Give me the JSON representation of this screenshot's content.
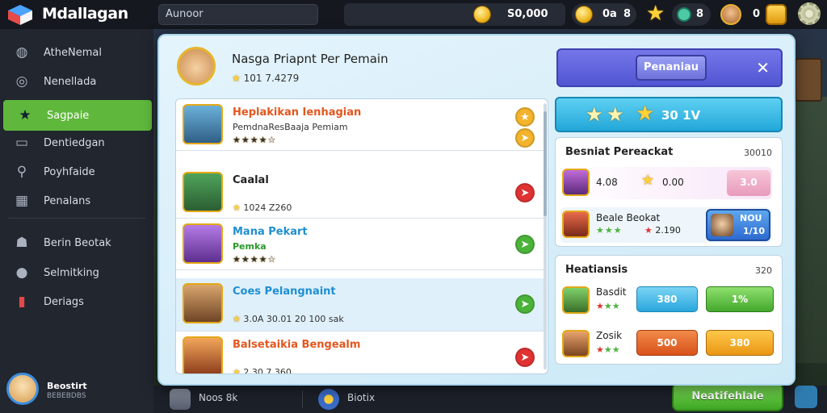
{
  "app": {
    "title": "Mdallagan",
    "search_value": "Aunoor"
  },
  "topbar": {
    "coins_value": "S0,000",
    "energy_value": "0a",
    "energy_sub": "8",
    "gems_value": "8",
    "player_value": "0"
  },
  "sidebar": {
    "items": [
      {
        "label": "AtheNemal",
        "icon": "profile-icon"
      },
      {
        "label": "Nenellada",
        "icon": "groups-icon"
      },
      {
        "label": "Sagpaie",
        "icon": "star-icon"
      },
      {
        "label": "Dentiedgan",
        "icon": "cards-icon"
      },
      {
        "label": "Poyhfaide",
        "icon": "search-icon"
      },
      {
        "label": "Penalans",
        "icon": "grid-icon"
      },
      {
        "label": "Berin Beotak",
        "icon": "people-icon"
      },
      {
        "label": "Selmitking",
        "icon": "chat-icon"
      },
      {
        "label": "Deriags",
        "icon": "alert-icon"
      }
    ],
    "profile_name": "Beostirt",
    "profile_sub": "BEBEBDBS"
  },
  "modal": {
    "title": "Nasga Priapnt Per Pemain",
    "subtitle": "101 7.4279",
    "top_button_label": "Penaniau",
    "stars_banner_value": "30 1V",
    "list": [
      {
        "name": "Heplakikan Ienhagian",
        "line2": "PemdnaResBaaja Pemiam",
        "stars": "★★★★☆",
        "action": "star",
        "name_color": "#e2571f"
      },
      {
        "name": "Caalal",
        "line2": "",
        "line3": "1024 Z260",
        "stars": "★",
        "action": "red",
        "name_color": "#222"
      },
      {
        "name": "Mana Pekart",
        "line2": "Pemka",
        "stars": "★★★★☆",
        "action": "green",
        "name_color": "#1f8fd0"
      },
      {
        "name": "Coes Pelangnaint",
        "line2": "",
        "line3": "3.0A  30.01  20 100 sak",
        "stars": "★",
        "action": "green",
        "name_color": "#1f8fd0"
      },
      {
        "name": "Balsetaikia Bengealm",
        "line2": "",
        "line3": "2.30 7.360",
        "stars": "★",
        "action": "red",
        "name_color": "#e2571f"
      }
    ],
    "recent": {
      "title": "Besniat Pereackat",
      "count": "30010",
      "row1_a": "4.08",
      "row1_b": "0.00",
      "row1_c": "3.0",
      "row2_name": "Beale Beokat",
      "row2_value": "2.190",
      "row2_badge": "NOU",
      "row2_badge_sub": "1/10"
    },
    "heat": {
      "title": "Heatiansis",
      "count": "320",
      "row1_name": "Basdit",
      "row1_p1": "380",
      "row1_p2": "1%",
      "row2_name": "Zosik",
      "row2_p1": "500",
      "row2_p2": "380"
    }
  },
  "bottombar": {
    "item1": "Noos 8k",
    "item2": "Biotix",
    "cta_label": "Neatifehlale"
  }
}
